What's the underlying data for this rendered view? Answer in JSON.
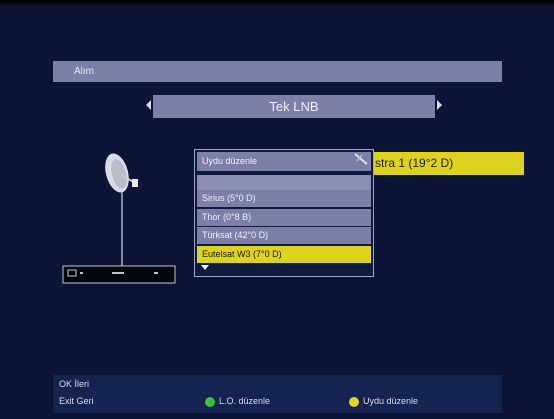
{
  "header": {
    "title": "Alım"
  },
  "lnb": {
    "value": "Tek LNB"
  },
  "satellite": {
    "value": "stra 1 (19°2 D)"
  },
  "dropdown": {
    "title": "Uydu düzenle",
    "items": [
      {
        "label": ""
      },
      {
        "label": "Sirius (5°0 D)"
      },
      {
        "label": "Thor (0°8 B)"
      },
      {
        "label": "Türksat (42°0 D)"
      },
      {
        "label": "Eutelsat W3 (7°0 D)",
        "selected": true
      }
    ]
  },
  "footer": {
    "ok_hint": "OK İleri",
    "exit_hint": "Exit Geri",
    "green_label": "L.O. düzenle",
    "yellow_label": "Uydu düzenle"
  },
  "colors": {
    "background": "#0c1535",
    "panel": "#7d7fa8",
    "highlight": "#dfd21e",
    "green_key": "#39c23a",
    "yellow_key": "#e0d520"
  }
}
